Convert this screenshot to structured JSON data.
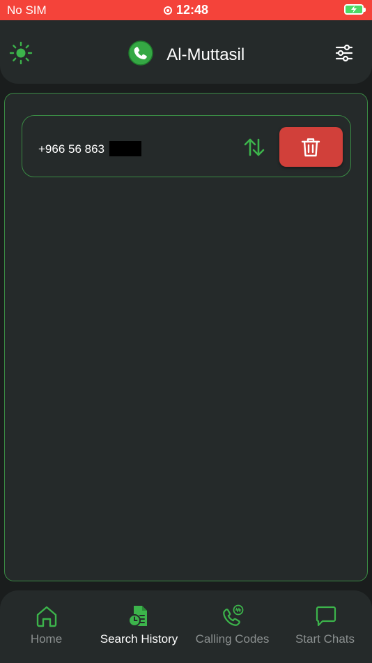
{
  "status_bar": {
    "carrier": "No SIM",
    "time": "12:48"
  },
  "header": {
    "title": "Al-Muttasil"
  },
  "history": {
    "items": [
      {
        "number": "+966 56 863"
      }
    ]
  },
  "bottom_nav": {
    "items": [
      {
        "label": "Home",
        "icon": "home-icon",
        "active": false
      },
      {
        "label": "Search History",
        "icon": "search-history-icon",
        "active": true
      },
      {
        "label": "Calling Codes",
        "icon": "calling-codes-icon",
        "active": false
      },
      {
        "label": "Start Chats",
        "icon": "chat-icon",
        "active": false
      }
    ]
  },
  "colors": {
    "accent": "#3cb44b",
    "status_bar": "#f4433a",
    "delete": "#d1403a",
    "surface": "#252a2a",
    "background": "#1a1d1d"
  }
}
